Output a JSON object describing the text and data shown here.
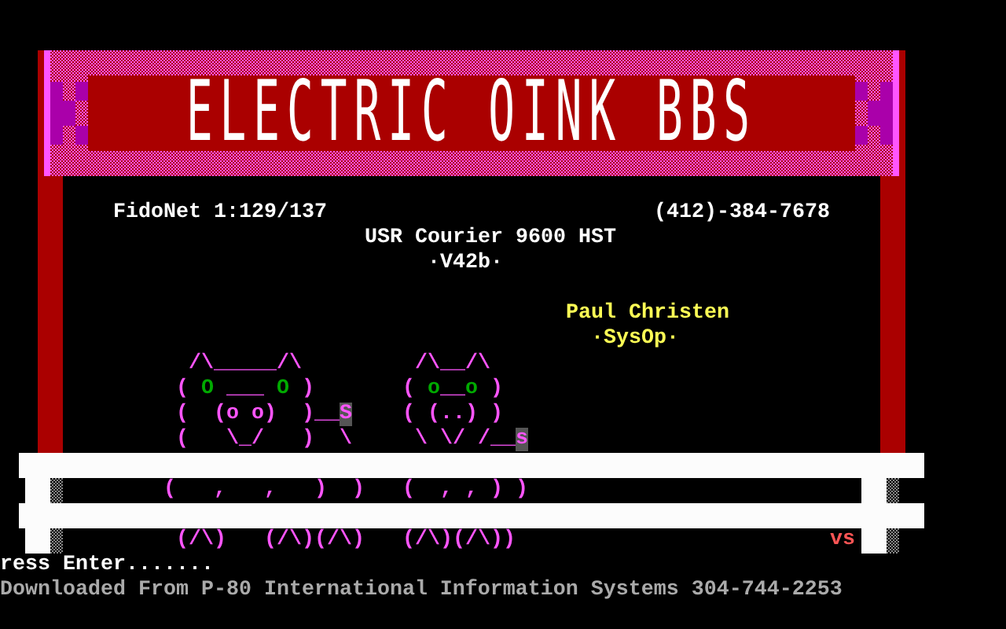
{
  "banner": {
    "title": "ELECTRIC OINK BBS"
  },
  "info": {
    "network": "FidoNet 1:129/137",
    "phone": "(412)-384-7678",
    "modem": "USR Courier 9600 HST",
    "protocol": "·V42b·",
    "sysop_name": "Paul Christen",
    "sysop_role": "·SysOp·"
  },
  "art": {
    "lines": [
      [
        {
          "kind": "plain",
          "text": "/\\_____/\\         /\\__/\\"
        }
      ],
      [
        {
          "kind": "plain",
          "text": "( "
        },
        {
          "kind": "eye",
          "text": "O"
        },
        {
          "kind": "plain",
          "text": " ___ "
        },
        {
          "kind": "eye",
          "text": "O"
        },
        {
          "kind": "plain",
          "text": " )       ( "
        },
        {
          "kind": "eye",
          "text": "o"
        },
        {
          "kind": "plain",
          "text": "__"
        },
        {
          "kind": "eye",
          "text": "o"
        },
        {
          "kind": "plain",
          "text": " )"
        }
      ],
      [
        {
          "kind": "plain",
          "text": "(  (o o)  )__"
        },
        {
          "kind": "highlight",
          "text": "S"
        },
        {
          "kind": "plain",
          "text": "    ( (..) )"
        }
      ],
      [
        {
          "kind": "plain",
          "text": "(   \\_/   )  \\     \\ \\/ /__"
        },
        {
          "kind": "highlight",
          "text": "s"
        }
      ],
      [
        {
          "kind": "plain",
          "text": "(   ,   ,   )  )   (  , , ) )"
        }
      ],
      [
        {
          "kind": "plain",
          "text": "(/\\)   (/\\)(/\\)   (/\\)(/\\))"
        }
      ]
    ]
  },
  "signature": "vs",
  "prompt": "ress Enter.......",
  "footer": "Downloaded From P-80 International Information Systems 304-744-2253"
}
